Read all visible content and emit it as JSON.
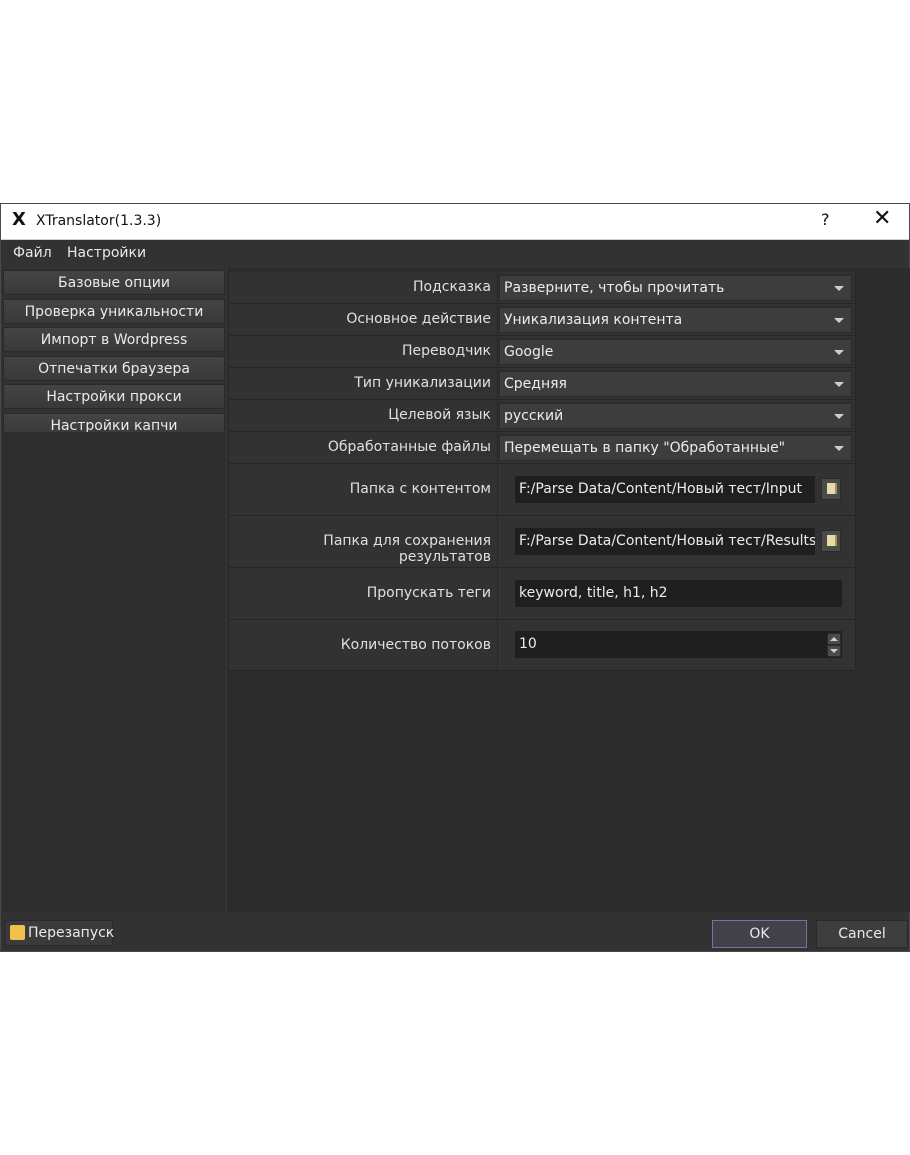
{
  "window": {
    "title": "XTranslator(1.3.3)",
    "app_icon": "x-logo-icon",
    "help_label": "?",
    "close_label": "✕"
  },
  "menubar": {
    "items": [
      "Файл",
      "Настройки"
    ]
  },
  "sidebar": {
    "items": [
      "Базовые опции",
      "Проверка уникальности",
      "Импорт в Wordpress",
      "Отпечатки браузера",
      "Настройки прокси",
      "Настройки капчи"
    ]
  },
  "settings": {
    "hint": {
      "label": "Подсказка",
      "value": "Разверните, чтобы прочитать"
    },
    "main_action": {
      "label": "Основное действие",
      "value": "Уникализация контента"
    },
    "translator": {
      "label": "Переводчик",
      "value": "Google"
    },
    "uniq_type": {
      "label": "Тип уникализации",
      "value": "Средняя"
    },
    "target_lang": {
      "label": "Целевой язык",
      "value": "русский"
    },
    "processed_files": {
      "label": "Обработанные файлы",
      "value": "Перемещать в папку \"Обработанные\""
    },
    "content_folder": {
      "label": "Папка с контентом",
      "value": "F:/Parse Data/Content/Новый тест/Input"
    },
    "results_folder": {
      "label": "Папка для сохранения результатов",
      "value": "F:/Parse Data/Content/Новый тест/Results"
    },
    "skip_tags": {
      "label": "Пропускать теги",
      "value": "keyword, title, h1, h2"
    },
    "threads": {
      "label": "Количество потоков",
      "value": "10"
    }
  },
  "footer": {
    "restart_label": "Перезапуск",
    "ok_label": "OK",
    "cancel_label": "Cancel"
  },
  "colors": {
    "window_bg": "#323232",
    "field_bg": "#1f1f1f",
    "ok_border": "#8a6aa0"
  }
}
